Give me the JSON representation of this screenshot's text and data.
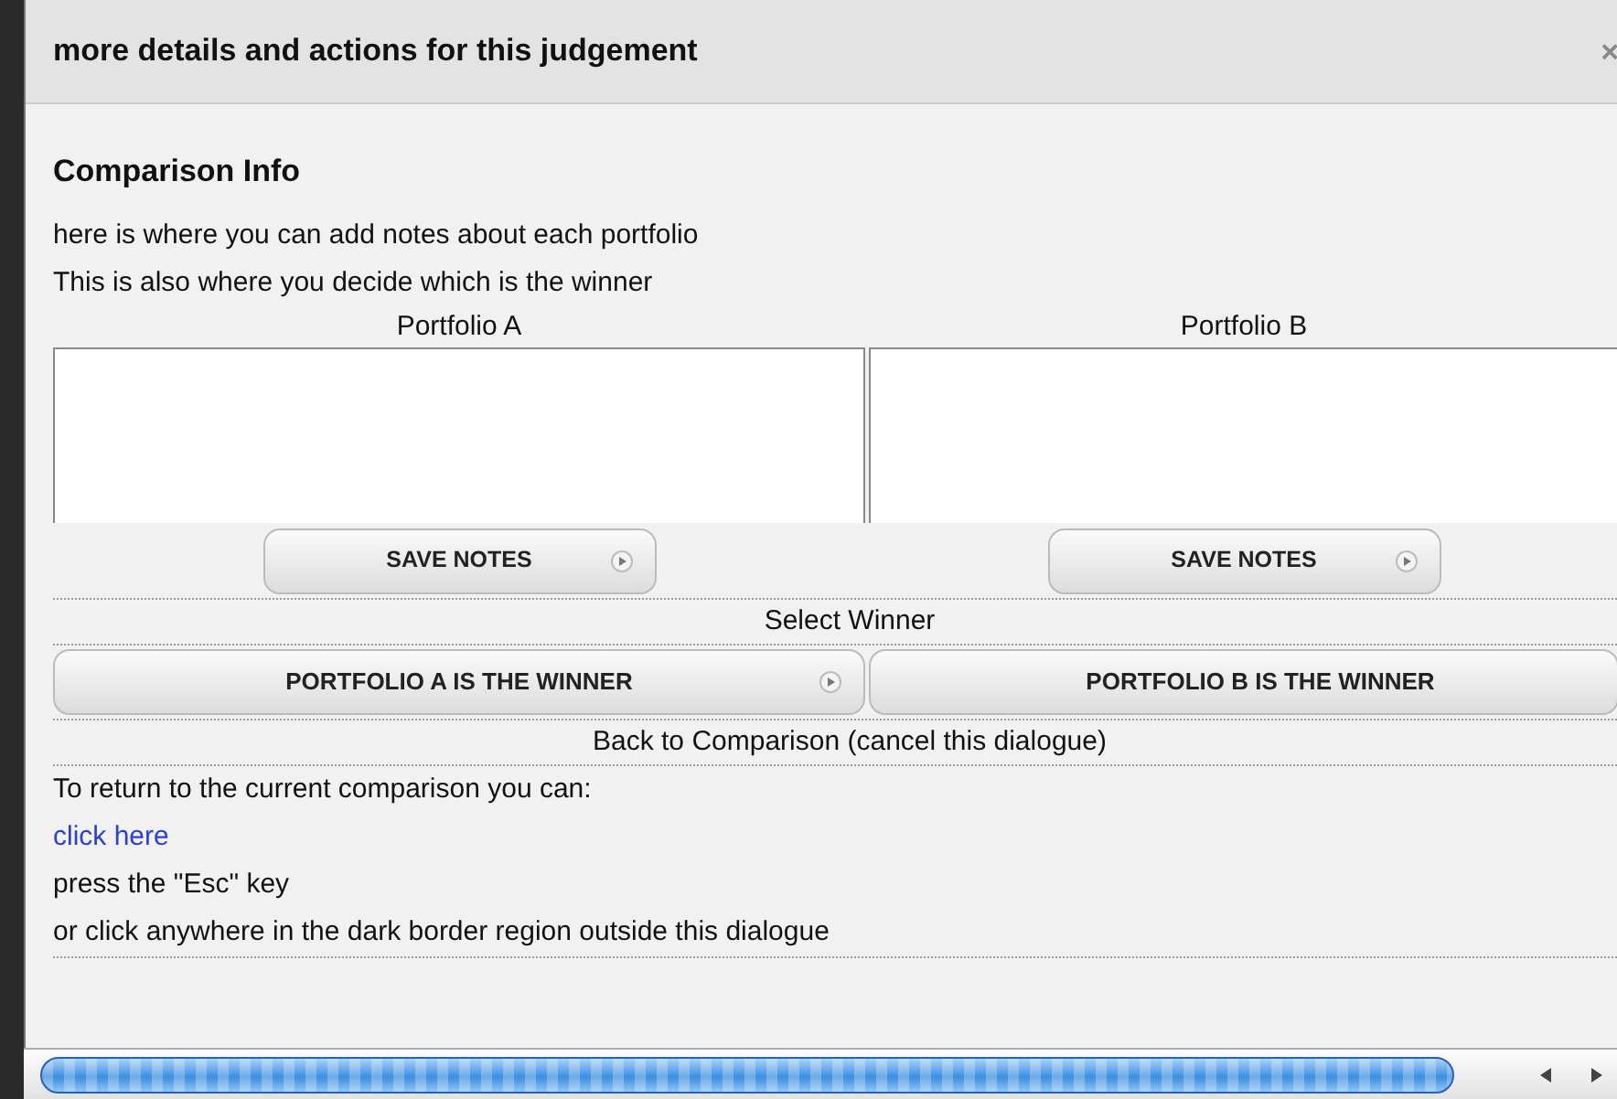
{
  "dialog": {
    "title": "more details and actions for this judgement",
    "close": "×"
  },
  "section_title": "Comparison Info",
  "intro": [
    "here is where you can add notes about each portfolio",
    "This is also where you decide which is the winner"
  ],
  "portfolios": [
    {
      "label": "Portfolio A",
      "save_button": "SAVE NOTES"
    },
    {
      "label": "Portfolio B",
      "save_button": "SAVE NOTES"
    }
  ],
  "select_winner": "Select Winner",
  "winner_buttons": [
    {
      "label": "PORTFOLIO A IS THE WINNER",
      "arrow": true
    },
    {
      "label": "PORTFOLIO B IS THE WINNER",
      "arrow": false
    }
  ],
  "back_heading": "Back to Comparison (cancel this dialogue)",
  "return_intro": "To return to the current comparison you can:",
  "link": "click here",
  "instructions": [
    "press the \"Esc\" key",
    "or click anywhere in the dark border region outside this dialogue"
  ]
}
